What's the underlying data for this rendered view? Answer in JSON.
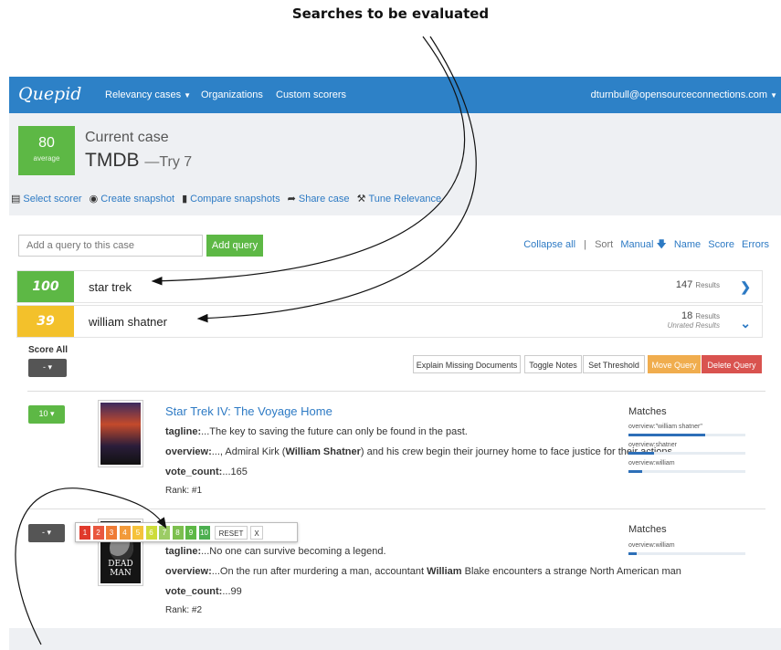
{
  "annotation": {
    "title": "Searches to be evaluated"
  },
  "nav": {
    "brand": "Quepid",
    "links": [
      "Relevancy cases",
      "Organizations",
      "Custom scorers"
    ],
    "user": "dturnbull@opensourceconnections.com"
  },
  "case": {
    "score": "80",
    "score_label": "average",
    "current_label": "Current case",
    "name": "TMDB",
    "try_label": "—Try 7",
    "tools": [
      "Select scorer",
      "Create snapshot",
      "Compare snapshots",
      "Share case",
      "Tune Relevance"
    ]
  },
  "query_bar": {
    "placeholder": "Add a query to this case",
    "add_label": "Add query",
    "collapse_all": "Collapse all",
    "separator": "|",
    "sort_label": "Sort",
    "sort_options": [
      "Manual",
      "Name",
      "Score",
      "Errors"
    ]
  },
  "queries": [
    {
      "score": "100",
      "text": "star trek",
      "results": "147",
      "results_label": "Results",
      "color": "#5db845"
    },
    {
      "score": "39",
      "text": "william shatner",
      "results": "18",
      "results_label": "Results",
      "unrated": "Unrated Results",
      "color": "#f3c12b"
    }
  ],
  "expanded": {
    "score_all_label": "Score All",
    "score_all_value": "-",
    "buttons": [
      "Explain Missing Documents",
      "Toggle Notes",
      "Set Threshold",
      "Move Query",
      "Delete Query"
    ]
  },
  "docs": [
    {
      "rating": "10",
      "title": "Star Trek IV: The Voyage Home",
      "tagline_label": "tagline:",
      "tagline": "...The key to saving the future can only be found in the past.",
      "overview_label": "overview:",
      "overview_pre": "..., Admiral Kirk (",
      "overview_bold": "William Shatner",
      "overview_post": ") and his crew begin their journey home to face justice for their actions",
      "vote_label": "vote_count:",
      "vote": "...165",
      "rank": "Rank: #1",
      "matches_label": "Matches",
      "matches": [
        {
          "label": "overview:\"william shatner\"",
          "fraction": 0.66
        },
        {
          "label": "overview:shatner",
          "fraction": 0.22
        },
        {
          "label": "overview:william",
          "fraction": 0.12
        }
      ]
    },
    {
      "rating": "-",
      "tagline_label": "tagline:",
      "tagline": "...No one can survive becoming a legend.",
      "overview_label": "overview:",
      "overview_pre": "...On the run after murdering a man, accountant ",
      "overview_bold": "William",
      "overview_post": " Blake encounters a strange North American man",
      "vote_label": "vote_count:",
      "vote": "...99",
      "rank": "Rank: #2",
      "poster_text": "DEAD MAN",
      "matches_label": "Matches",
      "matches": [
        {
          "label": "overview:william",
          "fraction": 0.07
        }
      ]
    }
  ],
  "rating_popup": {
    "values": [
      "1",
      "2",
      "3",
      "4",
      "5",
      "6",
      "7",
      "8",
      "9",
      "10"
    ],
    "colors": [
      "#e0392b",
      "#e9573f",
      "#ef7b35",
      "#f29a3a",
      "#f5c23b",
      "#cddc39",
      "#9ccc65",
      "#7cbf4e",
      "#5db845",
      "#4caf50"
    ],
    "reset": "RESET",
    "close": "X"
  }
}
